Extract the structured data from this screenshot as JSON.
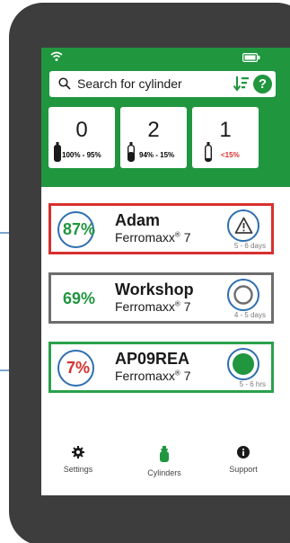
{
  "search": {
    "placeholder": "Search for cylinder"
  },
  "icons": {
    "wifi": "wifi-icon",
    "battery": "battery-icon",
    "search": "search-icon",
    "sort": "sort-icon",
    "help": "help-icon",
    "settings": "gear-icon",
    "cylinders": "cylinder-icon",
    "support": "info-icon"
  },
  "help_label": "?",
  "summary": [
    {
      "count": "0",
      "range": "100% - 95%",
      "color": "#20963f"
    },
    {
      "count": "2",
      "range": "94% - 15%",
      "color": "#20963f"
    },
    {
      "count": "1",
      "range": "<15%",
      "color": "#d7302f"
    }
  ],
  "cylinders": [
    {
      "percent": "87%",
      "percent_color": "#20963f",
      "name": "Adam",
      "model": "Ferromaxx",
      "model_mark": "®",
      "model_num": "7",
      "eta": "5 - 6 days",
      "status": "warning",
      "border": "#d7302f"
    },
    {
      "percent": "69%",
      "percent_color": "#20963f",
      "name": "Workshop",
      "model": "Ferromaxx",
      "model_mark": "®",
      "model_num": "7",
      "eta": "4 - 5 days",
      "status": "idle",
      "border": "#6d6d6d"
    },
    {
      "percent": "7%",
      "percent_color": "#d7302f",
      "name": "AP09REA",
      "model": "Ferromaxx",
      "model_mark": "®",
      "model_num": "7",
      "eta": "5 - 6 hrs",
      "status": "active",
      "border": "#2aa14b"
    }
  ],
  "nav": {
    "settings": "Settings",
    "cylinders": "Cylinders",
    "support": "Support"
  },
  "colors": {
    "brand_green": "#20963f",
    "alert_red": "#d7302f",
    "callout_blue": "#2f6fb0",
    "phone_body": "#3d3d3d"
  }
}
